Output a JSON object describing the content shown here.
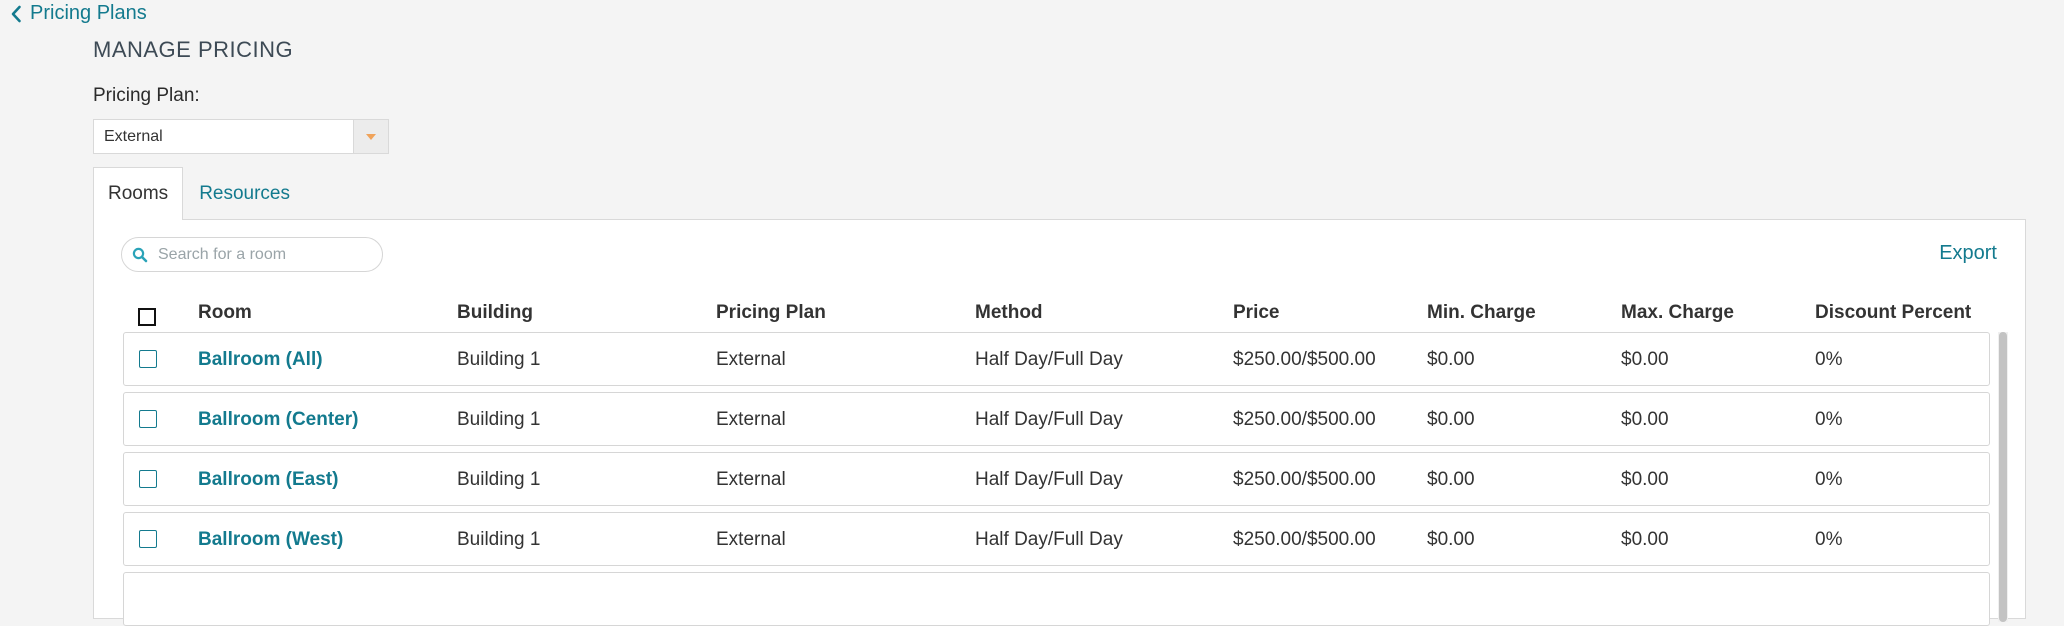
{
  "nav": {
    "back_label": "Pricing Plans"
  },
  "header": {
    "title": "MANAGE PRICING"
  },
  "plan": {
    "label": "Pricing Plan:",
    "selected": "External"
  },
  "tabs": [
    {
      "label": "Rooms",
      "active": true
    },
    {
      "label": "Resources",
      "active": false
    }
  ],
  "search": {
    "placeholder": "Search for a room"
  },
  "export_label": "Export",
  "table": {
    "columns": [
      "Room",
      "Building",
      "Pricing Plan",
      "Method",
      "Price",
      "Min. Charge",
      "Max. Charge",
      "Discount Percent"
    ],
    "rows": [
      {
        "room": "Ballroom (All)",
        "building": "Building 1",
        "plan": "External",
        "method": "Half Day/Full Day",
        "price": "$250.00/$500.00",
        "min": "$0.00",
        "max": "$0.00",
        "discount": "0%"
      },
      {
        "room": "Ballroom (Center)",
        "building": "Building 1",
        "plan": "External",
        "method": "Half Day/Full Day",
        "price": "$250.00/$500.00",
        "min": "$0.00",
        "max": "$0.00",
        "discount": "0%"
      },
      {
        "room": "Ballroom (East)",
        "building": "Building 1",
        "plan": "External",
        "method": "Half Day/Full Day",
        "price": "$250.00/$500.00",
        "min": "$0.00",
        "max": "$0.00",
        "discount": "0%"
      },
      {
        "room": "Ballroom (West)",
        "building": "Building 1",
        "plan": "External",
        "method": "Half Day/Full Day",
        "price": "$250.00/$500.00",
        "min": "$0.00",
        "max": "$0.00",
        "discount": "0%"
      }
    ]
  },
  "colors": {
    "accent": "#137a8e",
    "caret": "#f0a35a",
    "background": "#f4f4f4"
  },
  "icons": {
    "back": "chevron-left-icon",
    "dropdown": "caret-down-icon",
    "search": "search-icon"
  }
}
